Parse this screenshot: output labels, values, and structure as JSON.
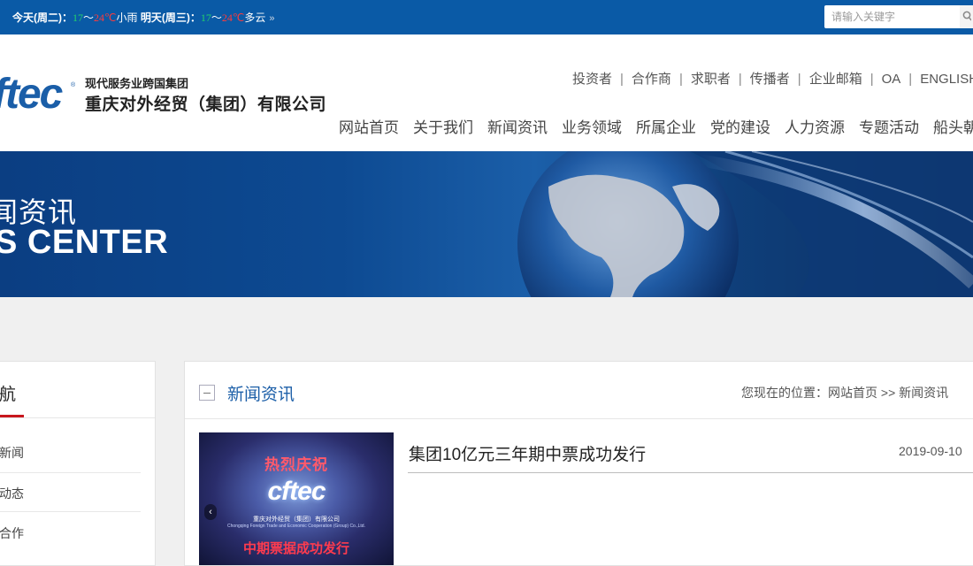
{
  "weather": {
    "today_label": "今天(周二)：",
    "today_low": "17",
    "tilde1": "～",
    "today_high": "24℃",
    "today_cond": "小雨",
    "tomorrow_label": "明天(周三)：",
    "tomorrow_low": "17",
    "tilde2": "～",
    "tomorrow_high": "24℃",
    "tomorrow_cond": "多云",
    "more_glyph": "»"
  },
  "search": {
    "placeholder": "请输入关键字"
  },
  "logo": {
    "mark": "ftec",
    "reg": "®",
    "tagline": "现代服务业跨国集团",
    "company": "重庆对外经贸（集团）有限公司"
  },
  "util_links": [
    "投资者",
    "合作商",
    "求职者",
    "传播者",
    "企业邮箱",
    "OA",
    "ENGLISH"
  ],
  "util_sep": "|",
  "nav": [
    "网站首页",
    "关于我们",
    "新闻资讯",
    "业务领域",
    "所属企业",
    "党的建设",
    "人力资源",
    "专题活动",
    "船头朝外"
  ],
  "banner": {
    "title_cn": "闻资讯",
    "title_en": "S CENTER"
  },
  "sidebar": {
    "title": "航",
    "items": [
      "新闻",
      "动态",
      "合作"
    ]
  },
  "main": {
    "title": "新闻资讯",
    "breadcrumb": "您现在的位置：网站首页 >> 新闻资讯"
  },
  "news": [
    {
      "title": "集团10亿元三年期中票成功发行",
      "date": "2019-09-10",
      "thumb_line1": "热烈庆祝",
      "thumb_logo": "cftec",
      "thumb_sub": "重庆对外经贸（集团）有限公司",
      "thumb_sub2": "Chongqing Foreign Trade and Economic Cooperation (Group) Co.,Ltd.",
      "thumb_line2": "中期票据成功发行",
      "thumb_prev": "‹"
    }
  ],
  "colors": {
    "topbar": "#0a5aa6",
    "brand_blue": "#1a5ea8",
    "accent_red": "#c8161d"
  }
}
